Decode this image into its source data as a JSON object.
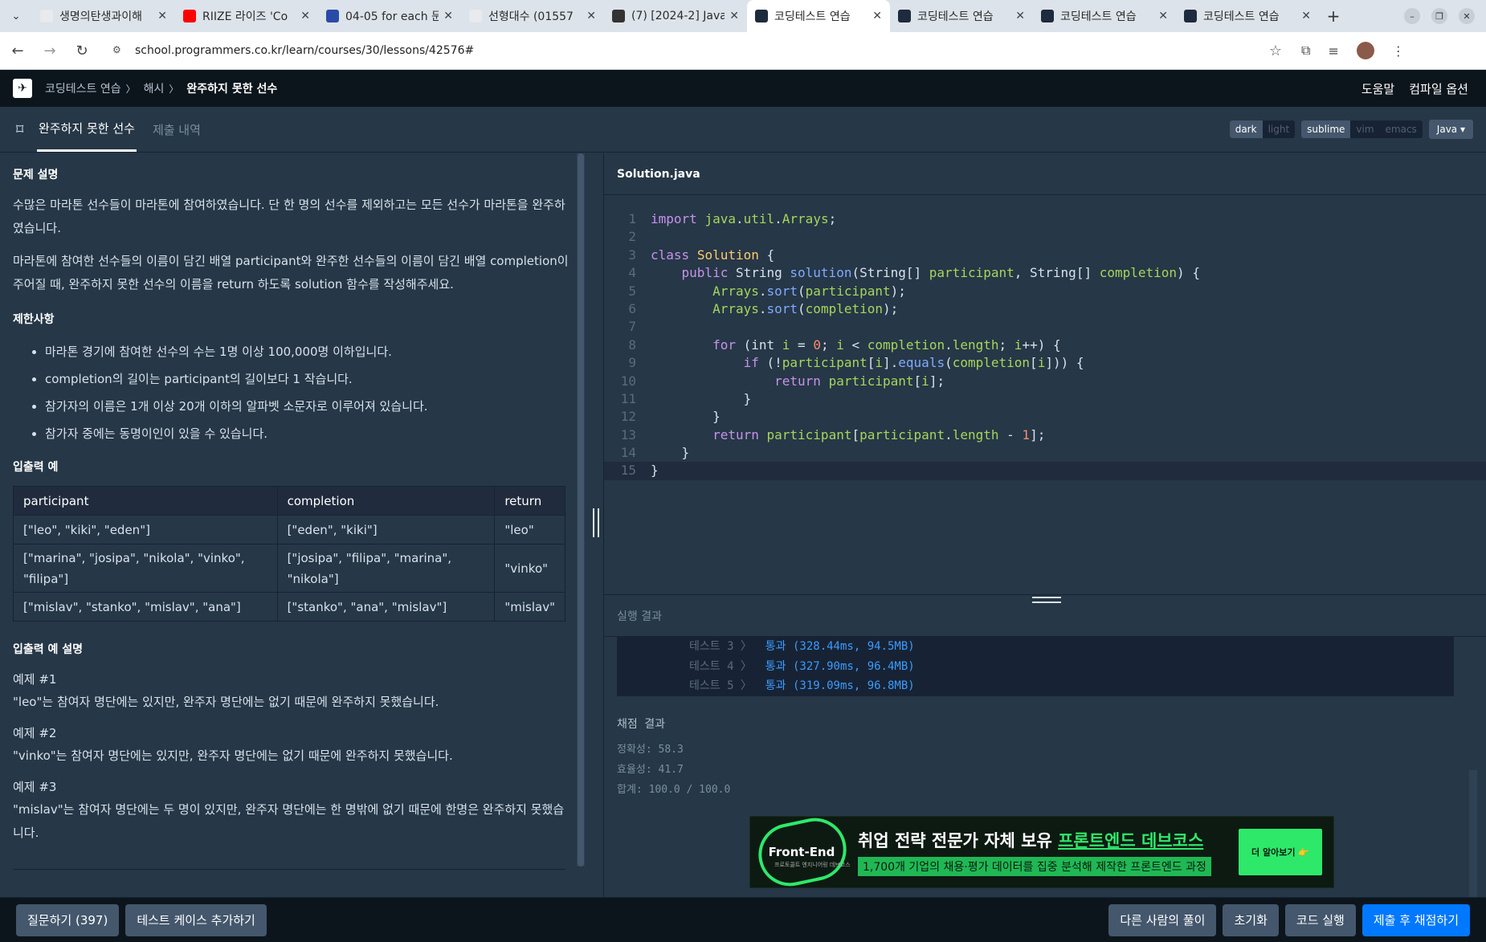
{
  "browser": {
    "tabs": [
      {
        "title": "생명의탄생과이해",
        "icon": "doc-icon",
        "color": "#e8eaed",
        "active": false
      },
      {
        "title": "RIIZE 라이즈 'Co",
        "icon": "youtube-icon",
        "color": "#ff0000",
        "active": false
      },
      {
        "title": "04-05 for each 문",
        "icon": "book-icon",
        "color": "#2a4aa8",
        "active": false
      },
      {
        "title": "선형대수 (01557",
        "icon": "doc-icon",
        "color": "#e8eaed",
        "active": false
      },
      {
        "title": "(7) [2024-2] Java",
        "icon": "notion-icon",
        "color": "#333333",
        "active": false
      },
      {
        "title": "코딩테스트 연습",
        "icon": "programmers-icon",
        "color": "#1e2b3c",
        "active": true
      },
      {
        "title": "코딩테스트 연습",
        "icon": "programmers-icon",
        "color": "#1e2b3c",
        "active": false
      },
      {
        "title": "코딩테스트 연습",
        "icon": "programmers-icon",
        "color": "#1e2b3c",
        "active": false
      },
      {
        "title": "코딩테스트 연습",
        "icon": "programmers-icon",
        "color": "#1e2b3c",
        "active": false
      }
    ],
    "url": "school.programmers.co.kr/learn/courses/30/lessons/42576#"
  },
  "header": {
    "breadcrumb": [
      "코딩테스트 연습",
      "해시",
      "완주하지 못한 선수"
    ],
    "help": "도움말",
    "compile_options": "컴파일 옵션"
  },
  "subheader": {
    "tab_problem": "완주하지 못한 선수",
    "tab_history": "제출 내역",
    "theme": [
      "dark",
      "light"
    ],
    "keymap": [
      "sublime",
      "vim",
      "emacs"
    ],
    "language": "Java"
  },
  "problem": {
    "desc_title": "문제 설명",
    "desc_p1": "수많은 마라톤 선수들이 마라톤에 참여하였습니다. 단 한 명의 선수를 제외하고는 모든 선수가 마라톤을 완주하였습니다.",
    "desc_p2": "마라톤에 참여한 선수들의 이름이 담긴 배열 participant와 완주한 선수들의 이름이 담긴 배열 completion이 주어질 때, 완주하지 못한 선수의 이름을 return 하도록 solution 함수를 작성해주세요.",
    "limits_title": "제한사항",
    "limits": [
      "마라톤 경기에 참여한 선수의 수는 1명 이상 100,000명 이하입니다.",
      "completion의 길이는 participant의 길이보다 1 작습니다.",
      "참가자의 이름은 1개 이상 20개 이하의 알파벳 소문자로 이루어져 있습니다.",
      "참가자 중에는 동명이인이 있을 수 있습니다."
    ],
    "io_title": "입출력 예",
    "io_headers": [
      "participant",
      "completion",
      "return"
    ],
    "io_rows": [
      [
        "[\"leo\", \"kiki\", \"eden\"]",
        "[\"eden\", \"kiki\"]",
        "\"leo\""
      ],
      [
        "[\"marina\", \"josipa\", \"nikola\", \"vinko\", \"filipa\"]",
        "[\"josipa\", \"filipa\", \"marina\", \"nikola\"]",
        "\"vinko\""
      ],
      [
        "[\"mislav\", \"stanko\", \"mislav\", \"ana\"]",
        "[\"stanko\", \"ana\", \"mislav\"]",
        "\"mislav\""
      ]
    ],
    "io_desc_title": "입출력 예 설명",
    "examples": [
      {
        "title": "예제 #1",
        "text": "\"leo\"는 참여자 명단에는 있지만, 완주자 명단에는 없기 때문에 완주하지 못했습니다."
      },
      {
        "title": "예제 #2",
        "text": "\"vinko\"는 참여자 명단에는 있지만, 완주자 명단에는 없기 때문에 완주하지 못했습니다."
      },
      {
        "title": "예제 #3",
        "text": "\"mislav\"는 참여자 명단에는 두 명이 있지만, 완주자 명단에는 한 명밖에 없기 때문에 한명은 완주하지 못했습니다."
      }
    ]
  },
  "editor": {
    "filename": "Solution.java",
    "lines": [
      "import java.util.Arrays;",
      "",
      "class Solution {",
      "    public String solution(String[] participant, String[] completion) {",
      "        Arrays.sort(participant);",
      "        Arrays.sort(completion);",
      "",
      "        for (int i = 0; i < completion.length; i++) {",
      "            if (!participant[i].equals(completion[i])) {",
      "                return participant[i];",
      "            }",
      "        }",
      "        return participant[participant.length - 1];",
      "    }",
      "}"
    ]
  },
  "results": {
    "title": "실행 결과",
    "tests": [
      {
        "label": "테스트 3 〉",
        "result": "통과 (328.44ms, 94.5MB)"
      },
      {
        "label": "테스트 4 〉",
        "result": "통과 (327.90ms, 96.4MB)"
      },
      {
        "label": "테스트 5 〉",
        "result": "통과 (319.09ms, 96.8MB)"
      }
    ],
    "grade_title": "채점 결과",
    "accuracy": "정확성: 58.3",
    "efficiency": "효율성: 41.7",
    "total": "합계: 100.0 / 100.0"
  },
  "banner": {
    "brand": "Front-End",
    "brand_sub": "프로토콜트 엔지니어링 데브코스",
    "line1_a": "취업 전략 전문가 자체 보유 ",
    "line1_b": "프론트엔드 데브코스",
    "line2": "1,700개 기업의 채용·평가 데이터를 집중 분석해 제작한 프론트엔드 과정",
    "cta": "더 알아보기 👉"
  },
  "footer": {
    "ask": "질문하기 (397)",
    "add_testcase": "테스트 케이스 추가하기",
    "others": "다른 사람의 풀이",
    "reset": "초기화",
    "run": "코드 실행",
    "submit": "제출 후 채점하기"
  }
}
